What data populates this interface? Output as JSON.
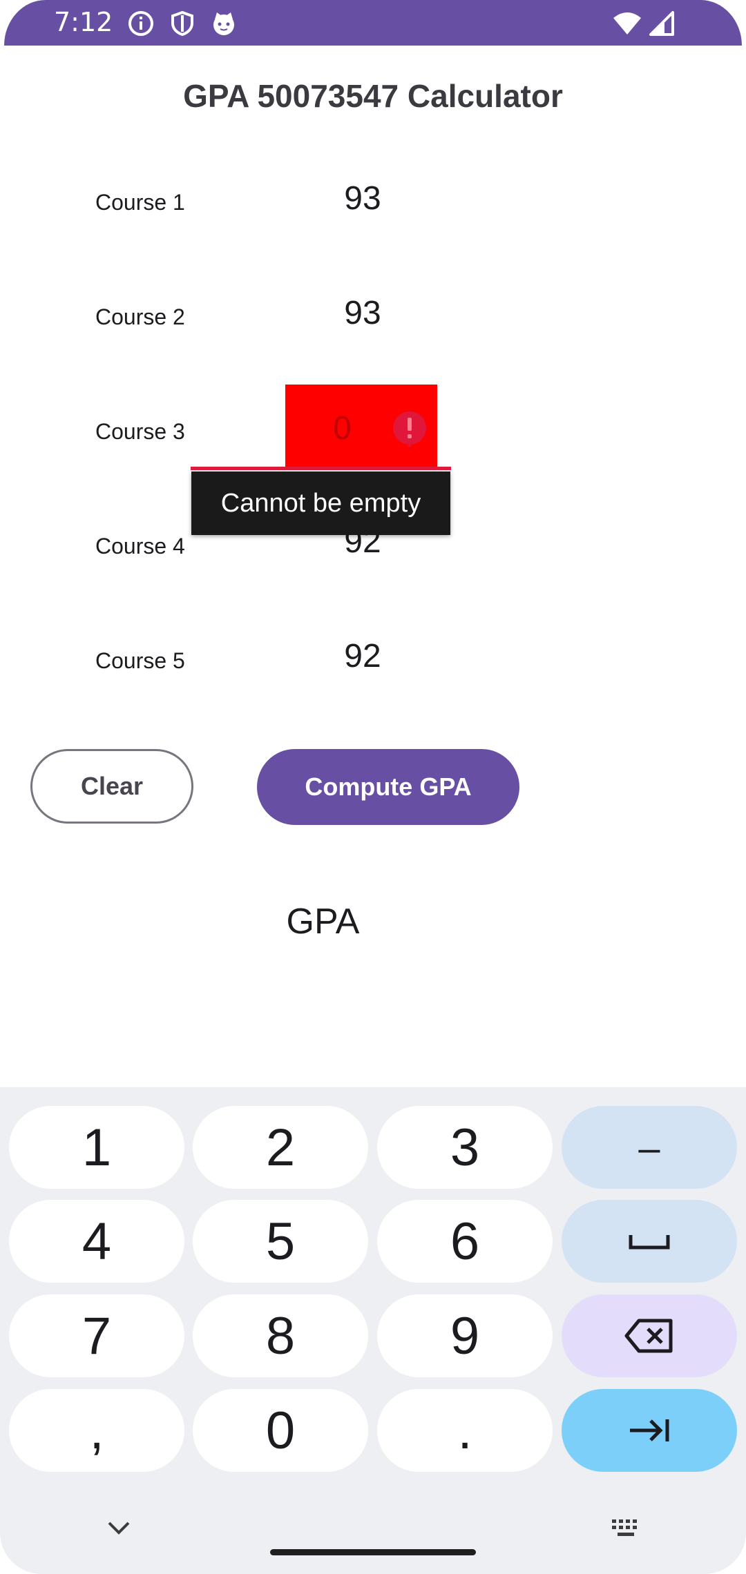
{
  "status_bar": {
    "time": "7:12"
  },
  "app": {
    "title": "GPA 50073547 Calculator"
  },
  "courses": [
    {
      "label": "Course 1",
      "value": "93"
    },
    {
      "label": "Course 2",
      "value": "93"
    },
    {
      "label": "Course 3",
      "value": "0"
    },
    {
      "label": "Course 4",
      "value": "92"
    },
    {
      "label": "Course 5",
      "value": "92"
    }
  ],
  "error": {
    "message": "Cannot be empty"
  },
  "buttons": {
    "clear": "Clear",
    "compute": "Compute GPA"
  },
  "result": {
    "label": "GPA"
  },
  "keyboard": {
    "keys": [
      "1",
      "2",
      "3",
      "–",
      "4",
      "5",
      "6",
      "␣",
      "7",
      "8",
      "9",
      "⌫",
      ",",
      "0",
      ".",
      "⇥"
    ]
  },
  "colors": {
    "primary": "#6750a4",
    "error_fill": "#ff0000",
    "tooltip_bg": "#1a1a1a",
    "key_blue": "#d3e3f4",
    "key_go": "#7ccff9"
  }
}
